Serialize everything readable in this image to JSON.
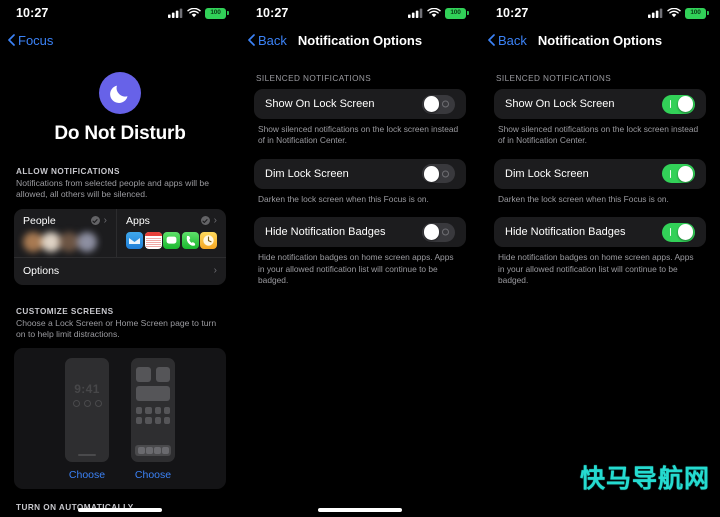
{
  "status_bar": {
    "time": "10:27",
    "battery_level": "100",
    "cell_icon": "cellular-bars-icon",
    "wifi_icon": "wifi-icon",
    "battery_icon": "battery-icon"
  },
  "colors": {
    "accent_blue": "#3b82f6",
    "toggle_on_green": "#32d158",
    "toggle_off_gray": "#39393d",
    "card_bg": "#1c1c1e",
    "dnd_purple": "#6762e8",
    "watermark": "#25dbd0"
  },
  "panel1": {
    "nav": {
      "back_label": "Focus"
    },
    "focus": {
      "icon": "moon-icon",
      "title": "Do Not Disturb"
    },
    "allow_section": {
      "header": "ALLOW NOTIFICATIONS",
      "description": "Notifications from selected people and apps will be allowed, all others will be silenced.",
      "people": {
        "title": "People",
        "badge_icon": "check-badge-icon",
        "chevron_icon": "chevron-right-icon"
      },
      "apps": {
        "title": "Apps",
        "badge_icon": "check-badge-icon",
        "chevron_icon": "chevron-right-icon",
        "app_icons": [
          "mail-app-icon",
          "calendar-app-icon",
          "messages-app-icon",
          "phone-app-icon",
          "clock-app-icon"
        ]
      },
      "options_row": {
        "label": "Options",
        "chevron_icon": "chevron-right-icon"
      }
    },
    "customize_section": {
      "header": "CUSTOMIZE SCREENS",
      "description": "Choose a Lock Screen or Home Screen page to turn on to help limit distractions.",
      "lock_screen": {
        "preview_time": "9:41",
        "choose_label": "Choose"
      },
      "home_screen": {
        "choose_label": "Choose"
      }
    },
    "turn_on_section": {
      "header": "TURN ON AUTOMATICALLY"
    }
  },
  "panel2": {
    "nav": {
      "back_label": "Back",
      "title": "Notification Options"
    },
    "section_header": "SILENCED NOTIFICATIONS",
    "rows": [
      {
        "label": "Show On Lock Screen",
        "state": "off",
        "footnote": "Show silenced notifications on the lock screen instead of in Notification Center."
      },
      {
        "label": "Dim Lock Screen",
        "state": "off",
        "footnote": "Darken the lock screen when this Focus is on."
      },
      {
        "label": "Hide Notification Badges",
        "state": "off",
        "footnote": "Hide notification badges on home screen apps. Apps in your allowed notification list will continue to be badged."
      }
    ]
  },
  "panel3": {
    "nav": {
      "back_label": "Back",
      "title": "Notification Options"
    },
    "section_header": "SILENCED NOTIFICATIONS",
    "rows": [
      {
        "label": "Show On Lock Screen",
        "state": "on",
        "footnote": "Show silenced notifications on the lock screen instead of in Notification Center."
      },
      {
        "label": "Dim Lock Screen",
        "state": "on",
        "footnote": "Darken the lock screen when this Focus is on."
      },
      {
        "label": "Hide Notification Badges",
        "state": "on",
        "footnote": "Hide notification badges on home screen apps. Apps in your allowed notification list will continue to be badged."
      }
    ]
  },
  "watermark": {
    "text": "快马导航网"
  }
}
